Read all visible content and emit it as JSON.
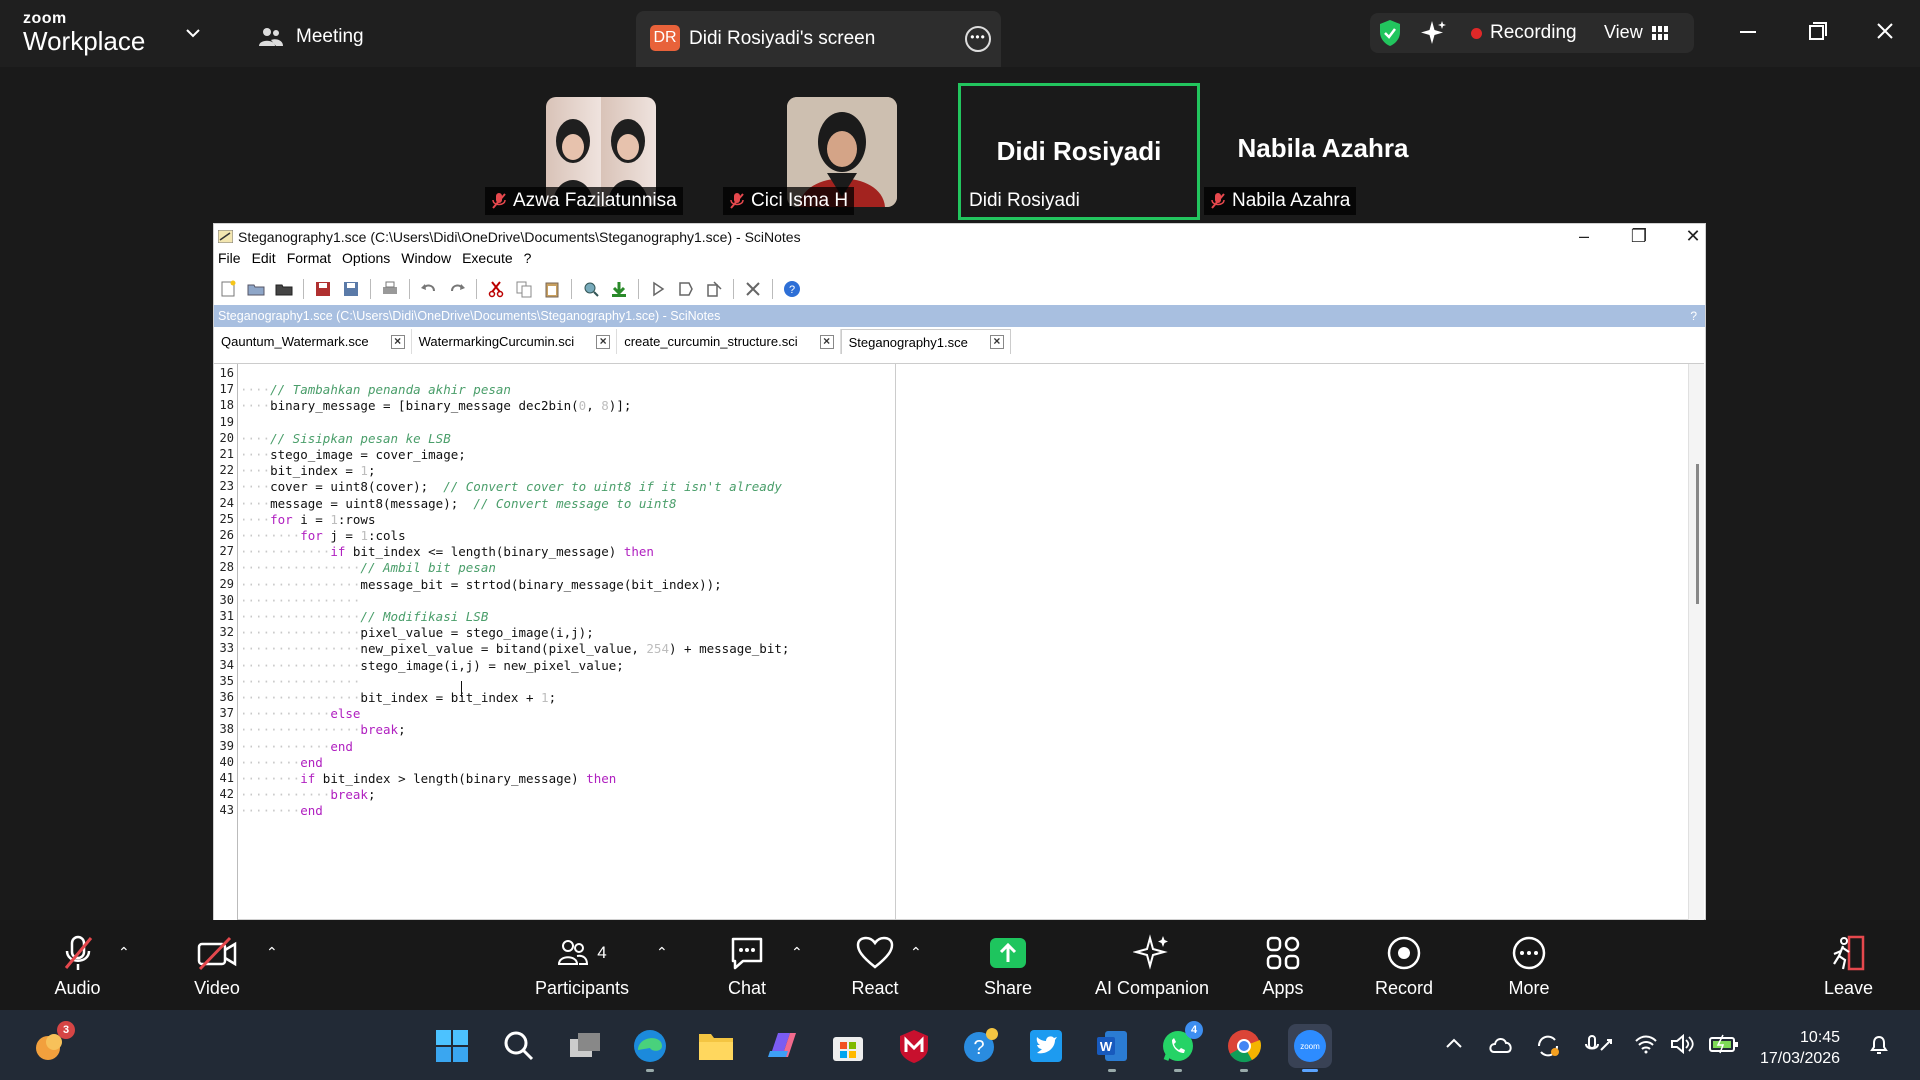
{
  "brand": {
    "line1": "zoom",
    "line2": "Workplace"
  },
  "meeting_label": "Meeting",
  "share_tab": {
    "initials": "DR",
    "title": "Didi Rosiyadi's screen"
  },
  "recording_label": "Recording",
  "view_label": "View",
  "participants": [
    {
      "name": "Azwa Fazilatunnisa",
      "muted": true
    },
    {
      "name": "Cici Isma H",
      "muted": true
    },
    {
      "name": "Didi Rosiyadi",
      "big": "Didi Rosiyadi",
      "active": true
    },
    {
      "name": "Nabila Azahra",
      "big": "Nabila Azahra",
      "muted": true
    }
  ],
  "scinotes": {
    "title": "Steganography1.sce (C:\\Users\\Didi\\OneDrive\\Documents\\Steganography1.sce) - SciNotes",
    "menu": [
      "File",
      "Edit",
      "Format",
      "Options",
      "Window",
      "Execute",
      "?"
    ],
    "path_bar": "Steganography1.sce (C:\\Users\\Didi\\OneDrive\\Documents\\Steganography1.sce) - SciNotes",
    "path_help": "?",
    "tabs": [
      "Qauntum_Watermark.sce",
      "WatermarkingCurcumin.sci",
      "create_curcumin_structure.sci",
      "Steganography1.sce"
    ],
    "active_tab": 3,
    "line_numbers": [
      "16",
      "17",
      "18",
      "19",
      "20",
      "21",
      "22",
      "23",
      "24",
      "25",
      "26",
      "27",
      "28",
      "29",
      "30",
      "31",
      "32",
      "33",
      "34",
      "35",
      "36",
      "37",
      "38",
      "39",
      "40",
      "41",
      "42",
      "43"
    ],
    "code_lines": [
      "",
      "// Tambahkan penanda akhir pesan",
      "binary_message = [binary_message dec2bin(0, 8)];",
      "",
      "// Sisipkan pesan ke LSB",
      "stego_image = cover_image;",
      "bit_index = 1;",
      "cover = uint8(cover);  // Convert cover to uint8 if it isn't already",
      "message = uint8(message);  // Convert message to uint8",
      "for i = 1:rows",
      "for j = 1:cols",
      "if bit_index <= length(binary_message) then",
      "// Ambil bit pesan",
      "message_bit = strtod(binary_message(bit_index));",
      "",
      "// Modifikasi LSB",
      "pixel_value = stego_image(i,j);",
      "new_pixel_value = bitand(pixel_value, 254) + message_bit;",
      "stego_image(i,j) = new_pixel_value;",
      "",
      "bit_index = bit_index + 1;",
      "else",
      "break;",
      "end",
      "end",
      "if bit_index > length(binary_message) then",
      "break;",
      "end"
    ]
  },
  "toolbar": {
    "audio": "Audio",
    "video": "Video",
    "participants": "Participants",
    "participant_count": "4",
    "chat": "Chat",
    "react": "React",
    "share": "Share",
    "ai": "AI Companion",
    "apps": "Apps",
    "record": "Record",
    "more": "More",
    "leave": "Leave"
  },
  "taskbar": {
    "weather_badge": "3",
    "whatsapp_badge": "4",
    "time": "10:45",
    "date": "17/03/2026"
  }
}
